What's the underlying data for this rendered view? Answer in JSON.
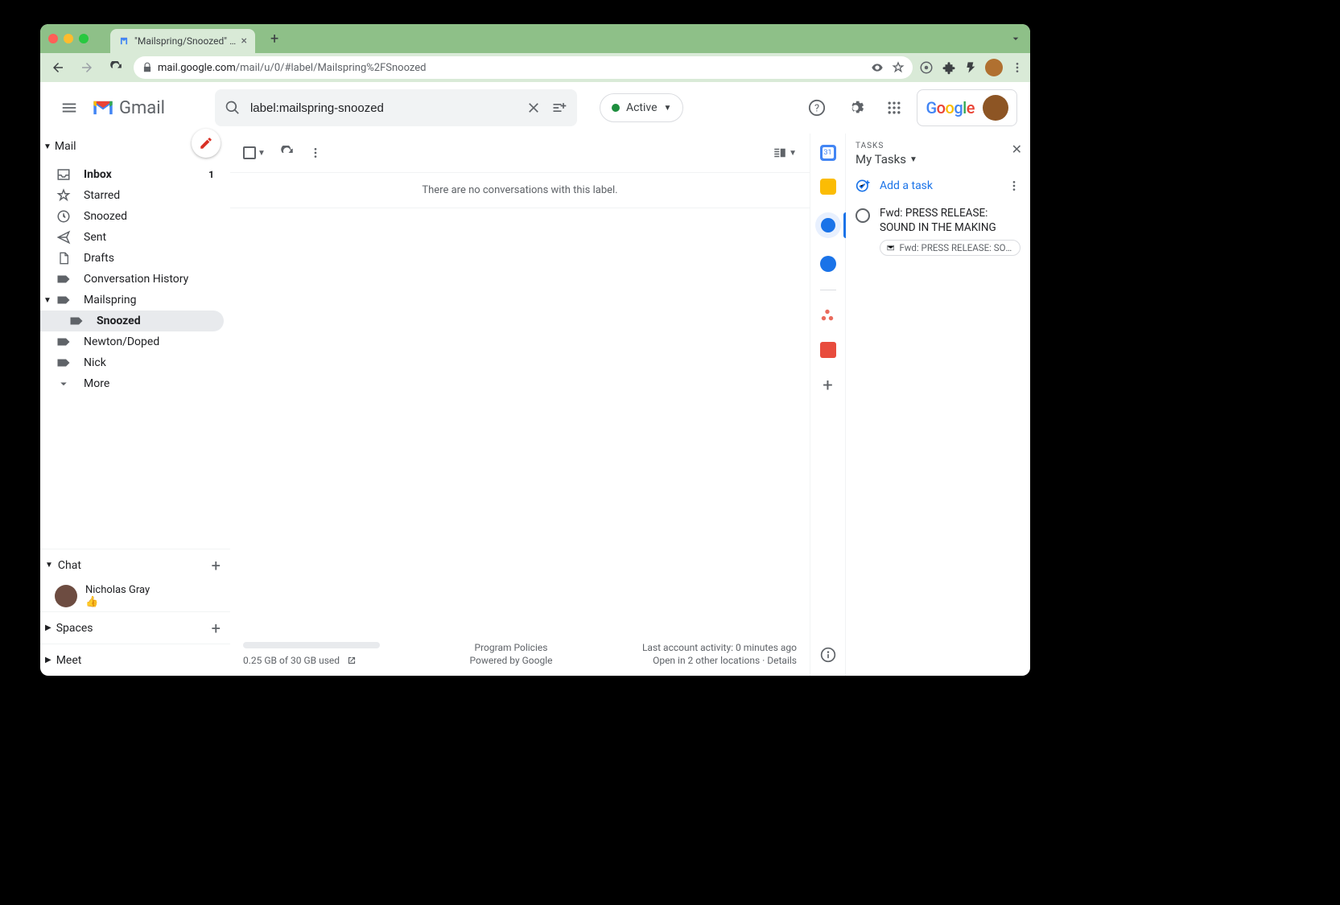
{
  "browser": {
    "tab_title": "\"Mailspring/Snoozed\" - andrew",
    "url_domain": "mail.google.com",
    "url_path": "/mail/u/0/#label/Mailspring%2FSnoozed"
  },
  "header": {
    "app_name": "Gmail",
    "search_value": "label:mailspring-snoozed",
    "status_chip": "Active"
  },
  "sidebar": {
    "mail": "Mail",
    "items": [
      {
        "label": "Inbox",
        "count": "1",
        "bold": true
      },
      {
        "label": "Starred"
      },
      {
        "label": "Snoozed"
      },
      {
        "label": "Sent"
      },
      {
        "label": "Drafts"
      },
      {
        "label": "Conversation History"
      },
      {
        "label": "Mailspring",
        "expandable": true
      },
      {
        "label": "Snoozed",
        "child": true,
        "selected": true
      },
      {
        "label": "Newton/Doped"
      },
      {
        "label": "Nick"
      },
      {
        "label": "More"
      }
    ],
    "sections": {
      "chat": "Chat",
      "spaces": "Spaces",
      "meet": "Meet"
    },
    "chat_contact": {
      "name": "Nicholas Gray",
      "message": "👍"
    }
  },
  "content": {
    "empty": "There are no conversations with this label."
  },
  "footer": {
    "storage": "0.25 GB of 30 GB used",
    "policies": "Program Policies",
    "powered": "Powered by Google",
    "activity": "Last account activity: 0 minutes ago",
    "locations": "Open in 2 other locations",
    "details": "Details"
  },
  "tasks": {
    "label": "TASKS",
    "list_name": "My Tasks",
    "add": "Add a task",
    "items": [
      {
        "title": "Fwd: PRESS RELEASE: SOUND IN THE MAKING",
        "chip": "Fwd: PRESS RELEASE: SOUND IN …"
      }
    ]
  }
}
